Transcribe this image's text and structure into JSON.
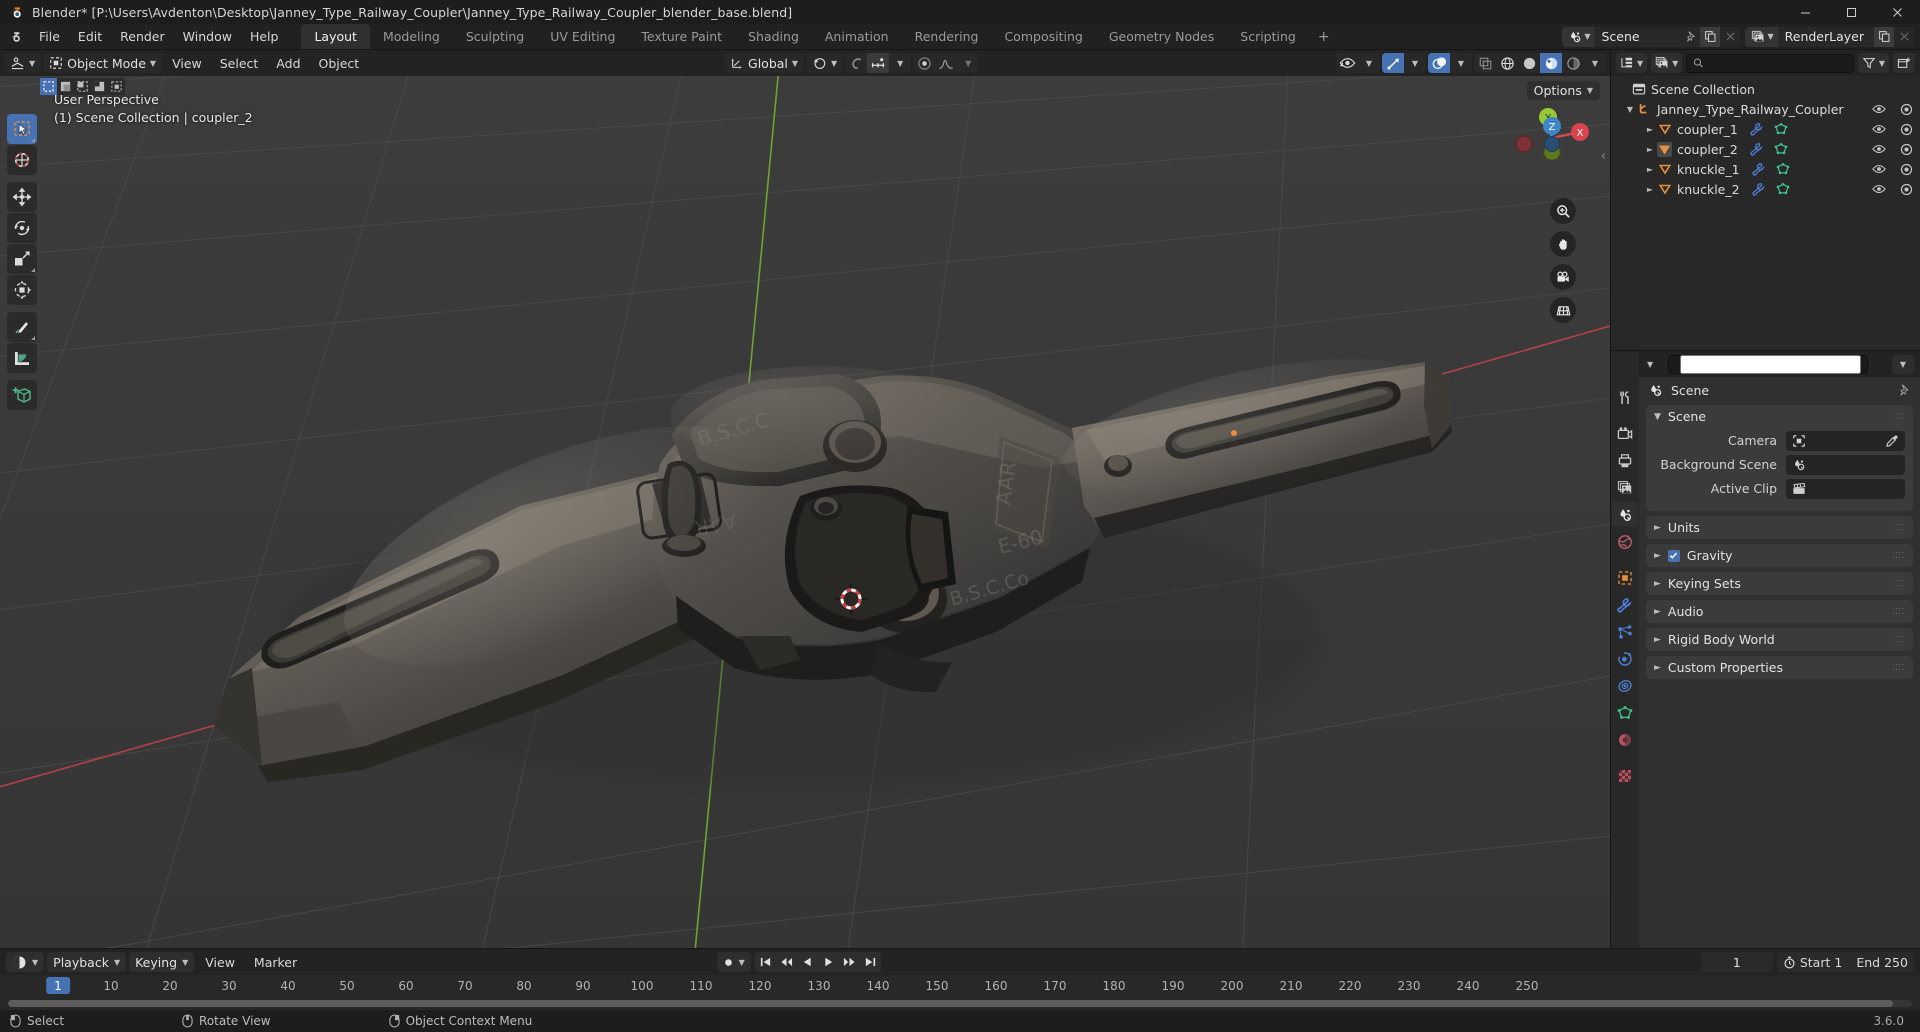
{
  "window": {
    "title": "Blender* [P:\\Users\\Avdenton\\Desktop\\Janney_Type_Railway_Coupler\\Janney_Type_Railway_Coupler_blender_base.blend]",
    "minimize": "—",
    "maximize": "▢",
    "close": "✕"
  },
  "topbar": {
    "menus": [
      "File",
      "Edit",
      "Render",
      "Window",
      "Help"
    ],
    "workspaces": [
      {
        "label": "Layout",
        "active": true
      },
      {
        "label": "Modeling",
        "active": false
      },
      {
        "label": "Sculpting",
        "active": false
      },
      {
        "label": "UV Editing",
        "active": false
      },
      {
        "label": "Texture Paint",
        "active": false
      },
      {
        "label": "Shading",
        "active": false
      },
      {
        "label": "Animation",
        "active": false
      },
      {
        "label": "Rendering",
        "active": false
      },
      {
        "label": "Compositing",
        "active": false
      },
      {
        "label": "Geometry Nodes",
        "active": false
      },
      {
        "label": "Scripting",
        "active": false
      }
    ],
    "add_workspace": "+",
    "scene_name": "Scene",
    "viewlayer_name": "RenderLayer"
  },
  "viewport": {
    "header": {
      "editor_type": "editor-type-3dview",
      "mode": "Object Mode",
      "menus": [
        "View",
        "Select",
        "Add",
        "Object"
      ],
      "transform_orientation": "Global",
      "options_label": "Options"
    },
    "overlay_line1": "User Perspective",
    "overlay_line2": "(1) Scene Collection | coupler_2",
    "gizmo_axes": [
      "X",
      "Y",
      "Z"
    ],
    "tools": [
      {
        "name": "tweak-tool",
        "active": true
      },
      {
        "name": "cursor-tool",
        "active": false
      },
      {
        "name": "move-tool",
        "active": false
      },
      {
        "name": "rotate-tool",
        "active": false
      },
      {
        "name": "scale-tool",
        "active": false
      },
      {
        "name": "transform-tool",
        "active": false
      },
      {
        "name": "annotate-tool",
        "active": false
      },
      {
        "name": "measure-tool",
        "active": false
      },
      {
        "name": "add-cube-tool",
        "active": false
      }
    ],
    "select_modes": [
      "set",
      "extend",
      "subtract",
      "invert",
      "intersect"
    ]
  },
  "outliner": {
    "display_mode": "view-layer",
    "search_placeholder": "",
    "filter_label": "filter-icon",
    "rows": [
      {
        "label": "Scene Collection",
        "indent": 0,
        "kind": "collection",
        "expander": "",
        "selected": false
      },
      {
        "label": "Janney_Type_Railway_Coupler",
        "indent": 1,
        "kind": "collection-orange",
        "expander": "▼",
        "selected": false
      },
      {
        "label": "coupler_1",
        "indent": 2,
        "kind": "mesh",
        "expander": "►",
        "selected": false
      },
      {
        "label": "coupler_2",
        "indent": 2,
        "kind": "mesh",
        "expander": "►",
        "selected": true
      },
      {
        "label": "knuckle_1",
        "indent": 2,
        "kind": "mesh",
        "expander": "►",
        "selected": false
      },
      {
        "label": "knuckle_2",
        "indent": 2,
        "kind": "mesh",
        "expander": "►",
        "selected": false
      }
    ]
  },
  "properties": {
    "breadcrumb": "Scene",
    "search_placeholder": "",
    "tabs": [
      {
        "name": "tool-tab",
        "active": false
      },
      {
        "name": "render-tab",
        "active": false
      },
      {
        "name": "output-tab",
        "active": false
      },
      {
        "name": "view-layer-tab",
        "active": false
      },
      {
        "name": "scene-tab",
        "active": true
      },
      {
        "name": "world-tab",
        "active": false
      },
      {
        "name": "object-tab",
        "active": false
      },
      {
        "name": "modifier-tab",
        "active": false
      },
      {
        "name": "particles-tab",
        "active": false
      },
      {
        "name": "physics-tab",
        "active": false
      },
      {
        "name": "constraint-tab",
        "active": false
      },
      {
        "name": "data-tab",
        "active": false
      },
      {
        "name": "material-tab",
        "active": false
      },
      {
        "name": "texture-tab",
        "active": false
      }
    ],
    "scene_panel": {
      "title": "Scene",
      "expanded": true,
      "fields": [
        {
          "label": "Camera",
          "value": "",
          "icon": "camera-icon",
          "eyedropper": true
        },
        {
          "label": "Background Scene",
          "value": "",
          "icon": "scene-icon",
          "eyedropper": false
        },
        {
          "label": "Active Clip",
          "value": "",
          "icon": "clip-icon",
          "eyedropper": false
        }
      ]
    },
    "panels": [
      {
        "title": "Units",
        "expanded": false,
        "checkbox": null
      },
      {
        "title": "Gravity",
        "expanded": false,
        "checkbox": true
      },
      {
        "title": "Keying Sets",
        "expanded": false,
        "checkbox": null
      },
      {
        "title": "Audio",
        "expanded": false,
        "checkbox": null
      },
      {
        "title": "Rigid Body World",
        "expanded": false,
        "checkbox": null
      },
      {
        "title": "Custom Properties",
        "expanded": false,
        "checkbox": null
      }
    ]
  },
  "timeline": {
    "menus": [
      "View",
      "Marker"
    ],
    "dropdowns": [
      "Playback",
      "Keying"
    ],
    "current_frame": "1",
    "start_label": "Start",
    "start_value": "1",
    "end_label": "End",
    "end_value": "250",
    "ticks": [
      10,
      20,
      30,
      40,
      50,
      60,
      70,
      80,
      90,
      100,
      110,
      120,
      130,
      140,
      150,
      160,
      170,
      180,
      190,
      200,
      210,
      220,
      230,
      240,
      250
    ],
    "playhead_label": "1"
  },
  "statusbar": {
    "items": [
      {
        "icon": "mouse-left-icon",
        "label": "Select"
      },
      {
        "icon": "mouse-middle-icon",
        "label": "Rotate View"
      },
      {
        "icon": "mouse-right-icon",
        "label": "Object Context Menu"
      }
    ],
    "version": "3.6.0"
  },
  "colors": {
    "accent": "#4772b3",
    "viewport_bg": "#393939",
    "panel_bg": "#303030",
    "header_bg": "#232323",
    "orange": "#e8913a",
    "green": "#3ec28f",
    "axis_x": "#c2424a",
    "axis_y": "#7dbd2e"
  }
}
